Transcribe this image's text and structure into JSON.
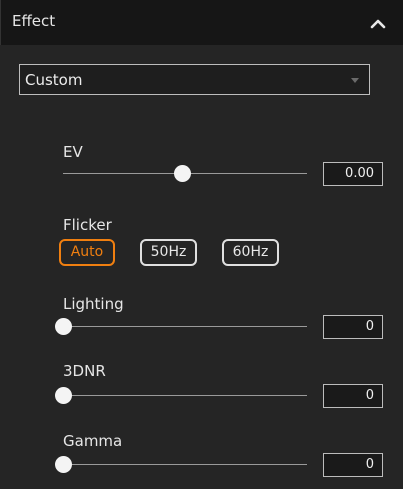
{
  "header": {
    "title": "Effect"
  },
  "preset": {
    "selected": "Custom"
  },
  "ev": {
    "label": "EV",
    "value": "0.00",
    "level": 0.49
  },
  "flicker": {
    "label": "Flicker",
    "options": [
      "Auto",
      "50Hz",
      "60Hz"
    ],
    "selected": "Auto"
  },
  "lighting": {
    "label": "Lighting",
    "value": "0",
    "level": 0
  },
  "dnr": {
    "label": "3DNR",
    "value": "0",
    "level": 0
  },
  "gamma": {
    "label": "Gamma",
    "value": "0",
    "level": 0
  },
  "colors": {
    "accent": "#f07f10",
    "panel": "#252525",
    "header": "#161616"
  },
  "icons": {
    "collapse": "chevron-up-icon",
    "dropdown": "caret-down-icon"
  }
}
